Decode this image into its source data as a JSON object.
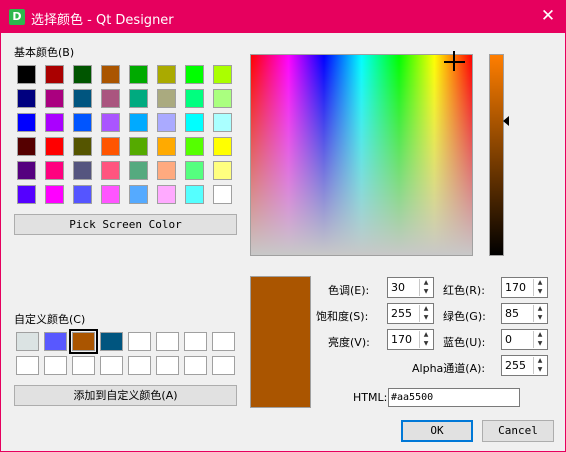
{
  "window": {
    "title": "选择颜色 - Qt Designer",
    "app_icon": "D"
  },
  "basic": {
    "label": "基本颜色(B)",
    "colors": [
      [
        "#000000",
        "#aa0000",
        "#005500",
        "#aa5500",
        "#00aa00",
        "#aaaa00",
        "#00ff00",
        "#aaff00"
      ],
      [
        "#00007f",
        "#aa007f",
        "#00557f",
        "#aa557f",
        "#00aa7f",
        "#aaaa7f",
        "#00ff7f",
        "#aaff7f"
      ],
      [
        "#0000ff",
        "#aa00ff",
        "#0055ff",
        "#aa55ff",
        "#00aaff",
        "#aaaaff",
        "#00ffff",
        "#aaffff"
      ],
      [
        "#550000",
        "#ff0000",
        "#555500",
        "#ff5500",
        "#55aa00",
        "#ffaa00",
        "#55ff00",
        "#ffff00"
      ],
      [
        "#55007f",
        "#ff007f",
        "#55557f",
        "#ff557f",
        "#55aa7f",
        "#ffaa7f",
        "#55ff7f",
        "#ffff7f"
      ],
      [
        "#5500ff",
        "#ff00ff",
        "#5555ff",
        "#ff55ff",
        "#55aaff",
        "#ffaaff",
        "#55ffff",
        "#ffffff"
      ]
    ]
  },
  "pick_screen_label": "Pick Screen Color",
  "custom": {
    "label": "自定义颜色(C)",
    "colors": [
      [
        "#dbe3e3",
        "#5858ff",
        "#aa5500",
        "#00557f",
        "#ffffff",
        "#ffffff",
        "#ffffff",
        "#ffffff"
      ],
      [
        "#ffffff",
        "#ffffff",
        "#ffffff",
        "#ffffff",
        "#ffffff",
        "#ffffff",
        "#ffffff",
        "#ffffff"
      ]
    ],
    "selected_index": 2
  },
  "add_custom_label": "添加到自定义颜色(A)",
  "current_color": "#aa5500",
  "fields": {
    "hue": {
      "label": "色调(E):",
      "value": "30"
    },
    "saturation": {
      "label": "饱和度(S):",
      "value": "255"
    },
    "value": {
      "label": "亮度(V):",
      "value": "170"
    },
    "red": {
      "label": "红色(R):",
      "value": "170"
    },
    "green": {
      "label": "绿色(G):",
      "value": "85"
    },
    "blue": {
      "label": "蓝色(U):",
      "value": "0"
    },
    "alpha": {
      "label": "Alpha通道(A):",
      "value": "255"
    }
  },
  "html": {
    "label": "HTML:",
    "value": "#aa5500"
  },
  "buttons": {
    "ok": "OK",
    "cancel": "Cancel"
  }
}
